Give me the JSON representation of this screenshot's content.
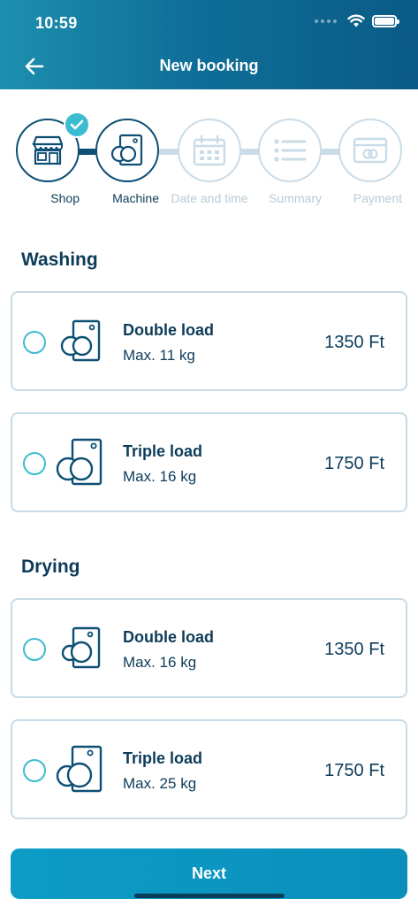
{
  "status_bar": {
    "time": "10:59"
  },
  "header": {
    "title": "New booking",
    "back_icon": "arrow-left-icon"
  },
  "stepper": {
    "steps": [
      {
        "label": "Shop",
        "state": "done",
        "icon": "shop-icon"
      },
      {
        "label": "Machine",
        "state": "current",
        "icon": "washer-icon"
      },
      {
        "label": "Date and time",
        "state": "upcoming",
        "icon": "calendar-icon"
      },
      {
        "label": "Summary",
        "state": "upcoming",
        "icon": "list-icon"
      },
      {
        "label": "Payment",
        "state": "upcoming",
        "icon": "card-icon"
      }
    ]
  },
  "sections": [
    {
      "title": "Washing",
      "machines": [
        {
          "name": "Double load",
          "capacity": "Max. 11 kg",
          "price": "1350 Ft",
          "selected": false,
          "icon": "washer-icon"
        },
        {
          "name": "Triple load",
          "capacity": "Max. 16 kg",
          "price": "1750 Ft",
          "selected": false,
          "icon": "washer-icon"
        }
      ]
    },
    {
      "title": "Drying",
      "machines": [
        {
          "name": "Double load",
          "capacity": "Max. 16 kg",
          "price": "1350 Ft",
          "selected": false,
          "icon": "dryer-icon"
        },
        {
          "name": "Triple load",
          "capacity": "Max. 25 kg",
          "price": "1750 Ft",
          "selected": false,
          "icon": "dryer-icon"
        }
      ]
    }
  ],
  "footer": {
    "next_label": "Next"
  },
  "colors": {
    "primary_dark": "#0d3c5a",
    "accent": "#3cbcd0",
    "button": "#0a8fbb",
    "inactive": "#c9dce7"
  }
}
